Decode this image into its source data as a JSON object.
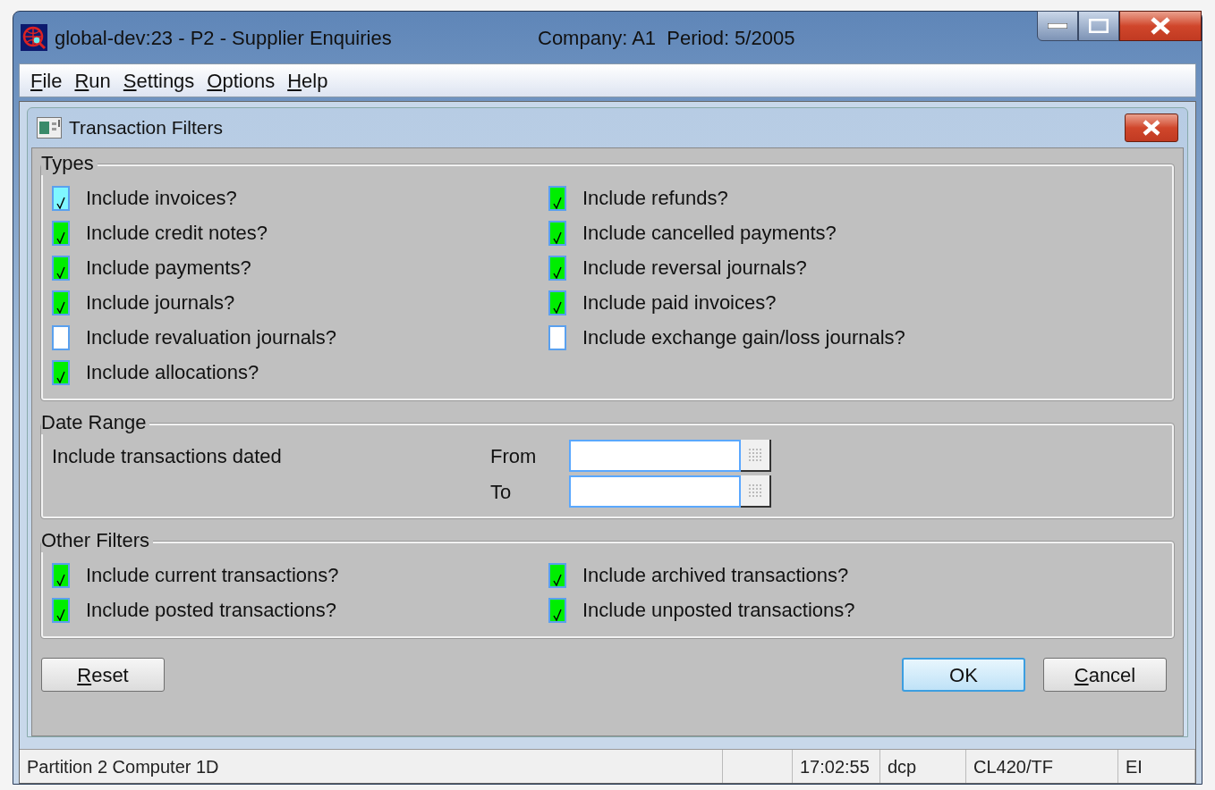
{
  "window": {
    "title": "global-dev:23 - P2 - Supplier Enquiries",
    "context": "Company: A1  Period: 5/2005"
  },
  "menu": [
    {
      "label": "File",
      "mnemonic": true
    },
    {
      "label": "Run",
      "mnemonic": true
    },
    {
      "label": "Settings",
      "mnemonic": true
    },
    {
      "label": "Options",
      "mnemonic": true
    },
    {
      "label": "Help",
      "mnemonic": true
    }
  ],
  "dialog": {
    "title": "Transaction Filters",
    "types": {
      "title": "Types",
      "left": [
        {
          "label": "Include invoices?",
          "checked": true,
          "focused": true
        },
        {
          "label": "Include credit notes?",
          "checked": true,
          "focused": false
        },
        {
          "label": "Include payments?",
          "checked": true,
          "focused": false
        },
        {
          "label": "Include journals?",
          "checked": true,
          "focused": false
        },
        {
          "label": "Include revaluation journals?",
          "checked": false,
          "focused": false
        },
        {
          "label": "Include allocations?",
          "checked": true,
          "focused": false
        }
      ],
      "right": [
        {
          "label": "Include refunds?",
          "checked": true,
          "focused": false
        },
        {
          "label": "Include cancelled payments?",
          "checked": true,
          "focused": false
        },
        {
          "label": "Include reversal journals?",
          "checked": true,
          "focused": false
        },
        {
          "label": "Include paid invoices?",
          "checked": true,
          "focused": false
        },
        {
          "label": "Include exchange gain/loss journals?",
          "checked": false,
          "focused": false
        }
      ]
    },
    "date_range": {
      "title": "Date Range",
      "label": "Include transactions dated",
      "from_label": "From",
      "to_label": "To"
    },
    "other_filters": {
      "title": "Other Filters",
      "left": [
        {
          "label": "Include current transactions?",
          "checked": true,
          "focused": false
        },
        {
          "label": "Include posted transactions?",
          "checked": true,
          "focused": false
        }
      ],
      "right": [
        {
          "label": "Include archived transactions?",
          "checked": true,
          "focused": false
        },
        {
          "label": "Include unposted transactions?",
          "checked": true,
          "focused": false
        }
      ]
    },
    "buttons": [
      {
        "label": "Reset",
        "mnemonic": true,
        "default": false
      },
      {
        "label": "OK",
        "mnemonic": false,
        "default": true
      },
      {
        "label": "Cancel",
        "mnemonic": true,
        "default": false
      }
    ]
  },
  "status_bar": [
    "Partition 2 Computer 1D",
    "17:02:55",
    "dcp",
    "CL420/TF",
    "EI"
  ]
}
